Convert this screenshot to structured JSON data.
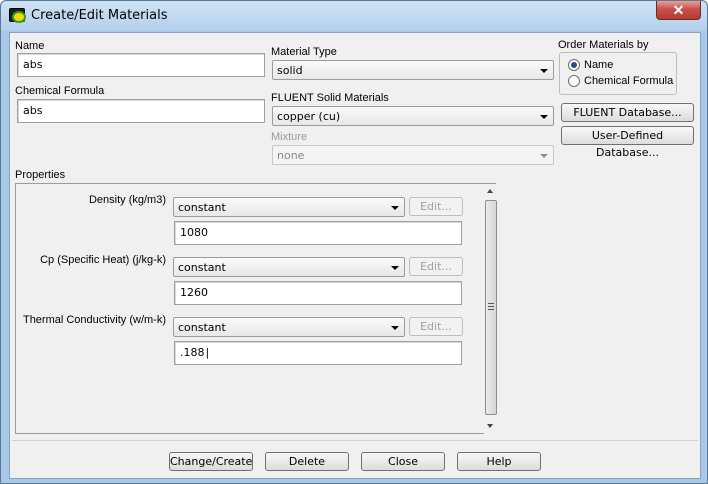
{
  "window": {
    "title": "Create/Edit Materials",
    "close_label": "✕"
  },
  "name": {
    "label": "Name",
    "value": "abs"
  },
  "chemical_formula": {
    "label": "Chemical Formula",
    "value": "abs"
  },
  "material_type": {
    "label": "Material Type",
    "value": "solid"
  },
  "fluent_solid_materials": {
    "label": "FLUENT Solid Materials",
    "value": "copper (cu)"
  },
  "mixture": {
    "label": "Mixture",
    "value": "none"
  },
  "order": {
    "label": "Order Materials by",
    "options": [
      {
        "label": "Name",
        "checked": true
      },
      {
        "label": "Chemical Formula",
        "checked": false
      }
    ]
  },
  "buttons": {
    "fluent_database": "FLUENT Database...",
    "user_defined_database": "User-Defined Database..."
  },
  "properties": {
    "label": "Properties",
    "items": [
      {
        "label": "Density (kg/m3)",
        "method": "constant",
        "edit": "Edit...",
        "value": "1080"
      },
      {
        "label": "Cp (Specific Heat) (j/kg-k)",
        "method": "constant",
        "edit": "Edit...",
        "value": "1260"
      },
      {
        "label": "Thermal Conductivity (w/m-k)",
        "method": "constant",
        "edit": "Edit...",
        "value": ".188"
      }
    ]
  },
  "footer": {
    "change_create": "Change/Create",
    "delete": "Delete",
    "close": "Close",
    "help": "Help"
  }
}
